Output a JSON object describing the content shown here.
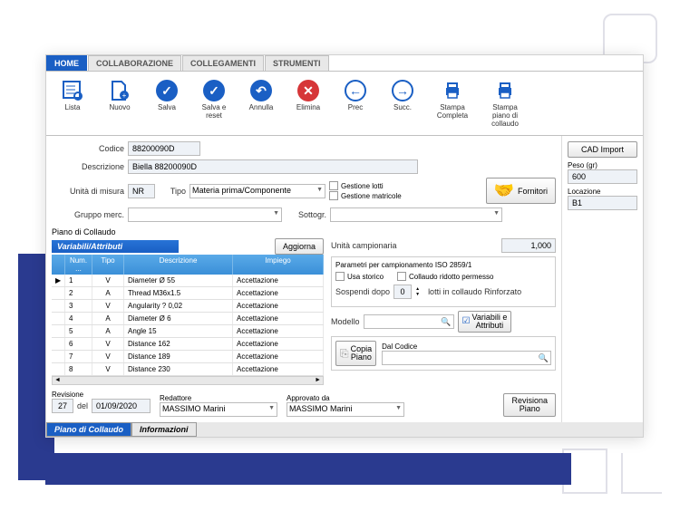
{
  "ribbon": {
    "tabs": [
      "HOME",
      "COLLABORAZIONE",
      "COLLEGAMENTI",
      "STRUMENTI"
    ]
  },
  "toolbar": {
    "lista": "Lista",
    "nuovo": "Nuovo",
    "salva": "Salva",
    "salva_reset": "Salva e\nreset",
    "annulla": "Annulla",
    "elimina": "Elimina",
    "prec": "Prec",
    "succ": "Succ.",
    "stampa_completa": "Stampa\nCompleta",
    "stampa_piano": "Stampa\npiano di\ncollaudo"
  },
  "form": {
    "codice_label": "Codice",
    "codice_value": "88200090D",
    "descrizione_label": "Descrizione",
    "descrizione_value": "Biella 88200090D",
    "unita_label": "Unità di misura",
    "unita_value": "NR",
    "tipo_label": "Tipo",
    "tipo_value": "Materia prima/Componente",
    "gestione_lotti": "Gestione lotti",
    "gestione_matricole": "Gestione matricole",
    "fornitori": "Fornitori",
    "gruppo_label": "Gruppo merc.",
    "sottogr_label": "Sottogr."
  },
  "side": {
    "cad_import": "CAD Import",
    "peso_label": "Peso (gr)",
    "peso_value": "600",
    "locazione_label": "Locazione",
    "locazione_value": "B1"
  },
  "piano": {
    "title": "Piano di Collaudo",
    "variabili_header": "Variabili/Attributi",
    "aggiorna": "Aggiorna",
    "cols": {
      "num": "Num. ...",
      "tipo": "Tipo",
      "desc": "Descrizione",
      "impiego": "Impiego"
    },
    "rows": [
      {
        "num": "1",
        "tipo": "V",
        "desc": "Diameter Ø 55",
        "impiego": "Accettazione"
      },
      {
        "num": "2",
        "tipo": "A",
        "desc": "Thread M36x1.5",
        "impiego": "Accettazione"
      },
      {
        "num": "3",
        "tipo": "V",
        "desc": "Angularity ? 0,02",
        "impiego": "Accettazione"
      },
      {
        "num": "4",
        "tipo": "A",
        "desc": "Diameter Ø 6",
        "impiego": "Accettazione"
      },
      {
        "num": "5",
        "tipo": "A",
        "desc": "Angle 15",
        "impiego": "Accettazione"
      },
      {
        "num": "6",
        "tipo": "V",
        "desc": "Distance 162",
        "impiego": "Accettazione"
      },
      {
        "num": "7",
        "tipo": "V",
        "desc": "Distance 189",
        "impiego": "Accettazione"
      },
      {
        "num": "8",
        "tipo": "V",
        "desc": "Distance 230",
        "impiego": "Accettazione"
      }
    ]
  },
  "campion": {
    "unita_label": "Unità campionaria",
    "unita_value": "1,000",
    "parametri": "Parametri per campionamento ISO 2859/1",
    "usa_storico": "Usa storico",
    "collaudo_ridotto": "Collaudo ridotto permesso",
    "sospendi_label": "Sospendi dopo",
    "sospendi_value": "0",
    "lotti_label": "lotti in collaudo Rinforzato",
    "modello_label": "Modello",
    "variabili_attributi": "Variabili e\nAttributi",
    "copia_piano": "Copia\nPiano",
    "dal_codice": "Dal Codice"
  },
  "revision": {
    "revisione_label": "Revisione",
    "revisione_num": "27",
    "del": "del",
    "data": "01/09/2020",
    "redattore_label": "Redattore",
    "redattore_value": "MASSIMO Marini",
    "approvato_label": "Approvato da",
    "approvato_value": "MASSIMO Marini",
    "revisiona_piano": "Revisiona\nPiano"
  },
  "bottom_tabs": {
    "piano": "Piano di Collaudo",
    "info": "Informazioni"
  }
}
